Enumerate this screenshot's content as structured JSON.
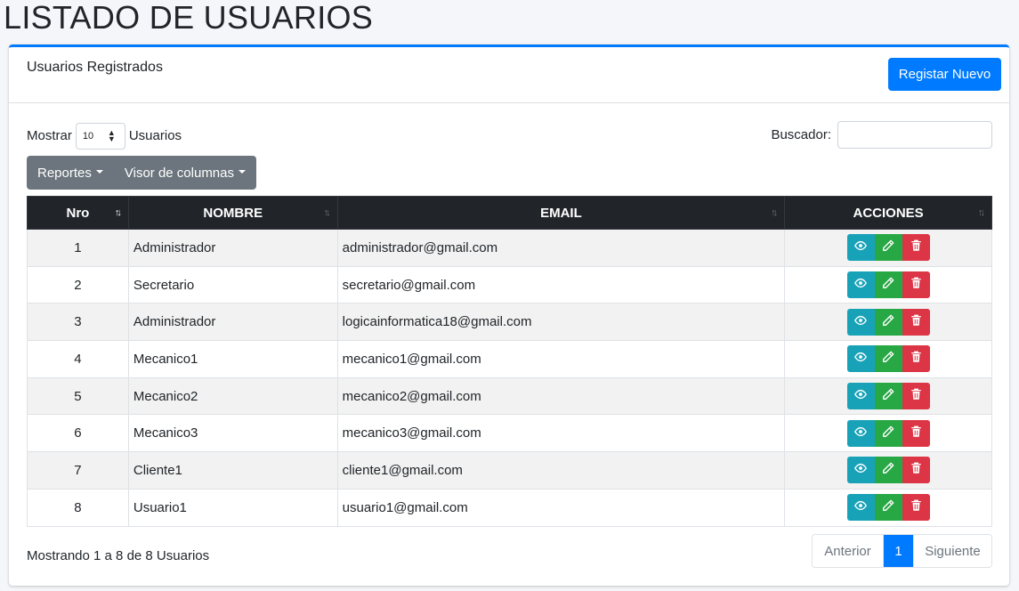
{
  "page": {
    "title": "LISTADO DE USUARIOS"
  },
  "card": {
    "title": "Usuarios Registrados",
    "new_button": "Registar Nuevo"
  },
  "length": {
    "prefix": "Mostrar",
    "value": "10",
    "suffix": "Usuarios"
  },
  "search": {
    "label": "Buscador:",
    "value": ""
  },
  "toolbar": {
    "reports": "Reportes",
    "columns": "Visor de columnas"
  },
  "table": {
    "headers": [
      "Nro",
      "NOMBRE",
      "EMAIL",
      "ACCIONES"
    ],
    "rows": [
      {
        "nro": "1",
        "nombre": "Administrador",
        "email": "administrador@gmail.com"
      },
      {
        "nro": "2",
        "nombre": "Secretario",
        "email": "secretario@gmail.com"
      },
      {
        "nro": "3",
        "nombre": "Administrador",
        "email": "logicainformatica18@gmail.com"
      },
      {
        "nro": "4",
        "nombre": "Mecanico1",
        "email": "mecanico1@gmail.com"
      },
      {
        "nro": "5",
        "nombre": "Mecanico2",
        "email": "mecanico2@gmail.com"
      },
      {
        "nro": "6",
        "nombre": "Mecanico3",
        "email": "mecanico3@gmail.com"
      },
      {
        "nro": "7",
        "nombre": "Cliente1",
        "email": "cliente1@gmail.com"
      },
      {
        "nro": "8",
        "nombre": "Usuario1",
        "email": "usuario1@gmail.com"
      }
    ]
  },
  "footer": {
    "info": "Mostrando 1 a 8 de 8 Usuarios"
  },
  "pagination": {
    "prev": "Anterior",
    "current": "1",
    "next": "Siguiente"
  },
  "colors": {
    "primary": "#007bff",
    "info": "#17a2b8",
    "success": "#28a745",
    "danger": "#dc3545",
    "secondary": "#6c757d",
    "dark": "#212529"
  },
  "icons": {
    "view": "eye-icon",
    "edit": "pencil-icon",
    "delete": "trash-icon"
  }
}
